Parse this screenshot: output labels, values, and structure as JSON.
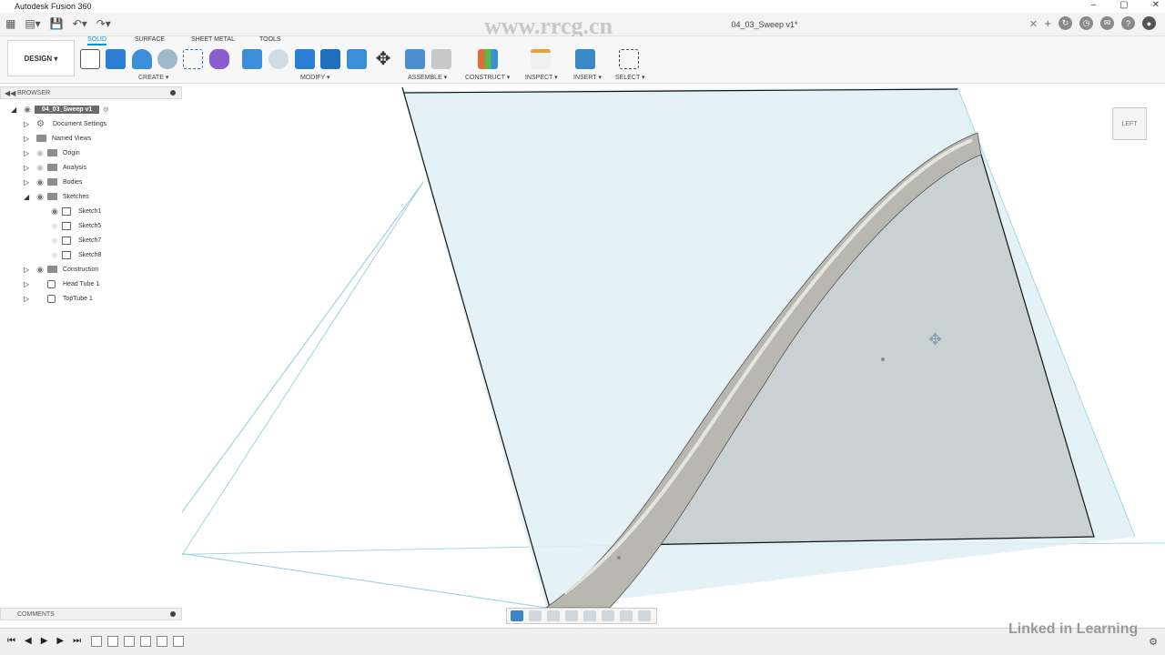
{
  "window": {
    "title": "Autodesk Fusion 360",
    "doc_tab": "04_03_Sweep v1*",
    "watermark_top": "www.rrcg.cn"
  },
  "ribbon": {
    "workspace": "DESIGN",
    "tabs": [
      "SOLID",
      "SURFACE",
      "SHEET METAL",
      "TOOLS"
    ],
    "groups": [
      "CREATE ▾",
      "MODIFY ▾",
      "ASSEMBLE ▾",
      "CONSTRUCT ▾",
      "INSPECT ▾",
      "INSERT ▾",
      "SELECT ▾"
    ]
  },
  "browser": {
    "title": "BROWSER",
    "root": "04_03_Sweep v1",
    "items": [
      "Document Settings",
      "Named Views",
      "Origin",
      "Analysis",
      "Bodies",
      "Sketches",
      "Sketch1",
      "Sketch5",
      "Sketch7",
      "Sketch8",
      "Construction",
      "Head Tube 1",
      "TopTube 1"
    ]
  },
  "viewcube": {
    "label": "LEFT"
  },
  "comments": {
    "title": "COMMENTS"
  },
  "footer": {
    "watermark": "Linked in Learning"
  },
  "colors": {
    "accent": "#0696d7",
    "plane": "#dff0f6",
    "profile": "#c8d0d4"
  }
}
